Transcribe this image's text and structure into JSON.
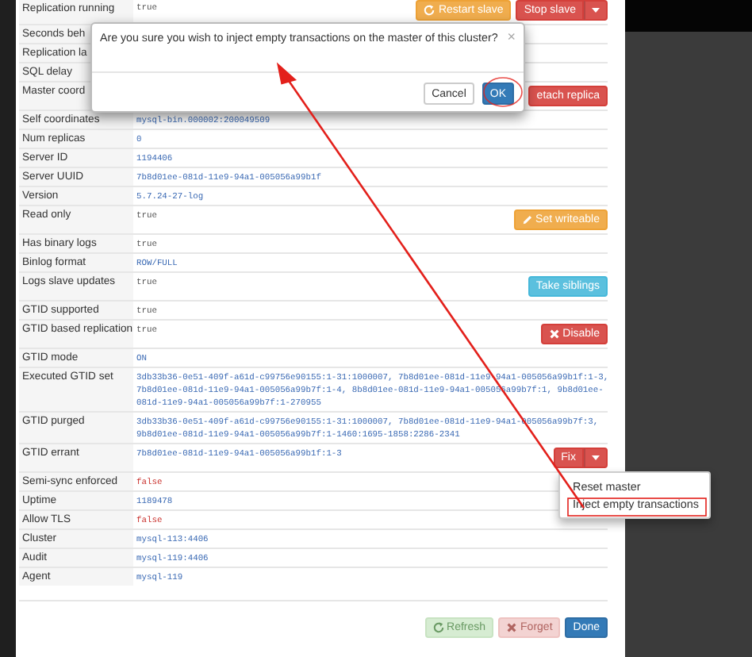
{
  "rows": [
    {
      "label": "Replication running",
      "value": [
        "true"
      ],
      "kind": "flag",
      "actions": [
        {
          "label": "Restart slave",
          "kind": "restart"
        },
        {
          "label": "Stop slave",
          "kind": "stop",
          "caret": true
        }
      ]
    },
    {
      "label": "Seconds beh"
    },
    {
      "label": "Replication la"
    },
    {
      "label": "SQL delay"
    },
    {
      "label": "Master coord",
      "actions": [
        {
          "label": "etach replica",
          "kind": "stop"
        }
      ]
    },
    {
      "label": "Self coordinates",
      "value": [
        "mysql-bin.000002:200049509"
      ],
      "kind": "info"
    },
    {
      "label": "Num replicas",
      "value": [
        "0"
      ],
      "kind": "info"
    },
    {
      "label": "Server ID",
      "value": [
        "1194406"
      ],
      "kind": "info"
    },
    {
      "label": "Server UUID",
      "value": [
        "7b8d01ee-081d-11e9-94a1-005056a99b1f"
      ],
      "kind": "info"
    },
    {
      "label": "Version",
      "value": [
        "5.7.24-27-log"
      ],
      "kind": "info"
    },
    {
      "label": "Read only",
      "value": [
        "true"
      ],
      "kind": "flag",
      "actions": [
        {
          "label": "Set writeable",
          "kind": "edit"
        }
      ]
    },
    {
      "label": "Has binary logs",
      "value": [
        "true"
      ],
      "kind": "flag"
    },
    {
      "label": "Binlog format",
      "value": [
        "ROW/FULL"
      ],
      "kind": "info"
    },
    {
      "label": "Logs slave updates",
      "value": [
        "true"
      ],
      "kind": "flag",
      "actions": [
        {
          "label": "Take siblings",
          "kind": "move"
        }
      ]
    },
    {
      "label": "GTID supported",
      "value": [
        "true"
      ],
      "kind": "flag"
    },
    {
      "label": "GTID based replication",
      "value": [
        "true"
      ],
      "kind": "flag",
      "actions": [
        {
          "label": "Disable",
          "kind": "remove"
        }
      ]
    },
    {
      "label": "GTID mode",
      "value": [
        "ON"
      ],
      "kind": "info"
    },
    {
      "label": "Executed GTID set",
      "value": [
        "3db33b36-0e51-409f-a61d-c99756e90155:1-31:1000007, 7b8d01ee-081d-11e9-94a1-005056a99b1f:1-3,",
        "7b8d01ee-081d-11e9-94a1-005056a99b7f:1-4, 8b8d01ee-081d-11e9-94a1-005056a99b7f:1, 9b8d01ee-",
        "081d-11e9-94a1-005056a99b7f:1-270955"
      ],
      "kind": "info"
    },
    {
      "label": "GTID purged",
      "value": [
        "3db33b36-0e51-409f-a61d-c99756e90155:1-31:1000007, 7b8d01ee-081d-11e9-94a1-005056a99b7f:3,",
        "9b8d01ee-081d-11e9-94a1-005056a99b7f:1-1460:1695-1858:2286-2341"
      ],
      "kind": "info"
    },
    {
      "label": "GTID errant",
      "value": [
        "7b8d01ee-081d-11e9-94a1-005056a99b1f:1-3"
      ],
      "kind": "info",
      "actions": [
        {
          "label": "Fix",
          "kind": "stop",
          "caret": true
        }
      ]
    },
    {
      "label": "Semi-sync enforced",
      "value": [
        "false"
      ],
      "kind": "alert"
    },
    {
      "label": "Uptime",
      "value": [
        "1189478"
      ],
      "kind": "info"
    },
    {
      "label": "Allow TLS",
      "value": [
        "false"
      ],
      "kind": "alert"
    },
    {
      "label": "Cluster",
      "value": [
        "mysql-113:4406"
      ],
      "kind": "info"
    },
    {
      "label": "Audit",
      "value": [
        "mysql-119:4406"
      ],
      "kind": "info"
    },
    {
      "label": "Agent",
      "value": [
        "mysql-119"
      ],
      "kind": "info"
    }
  ],
  "footer": [
    {
      "label": "Refresh",
      "kind": "refresh",
      "disabled": true
    },
    {
      "label": "Forget",
      "kind": "forget",
      "disabled": true
    },
    {
      "label": "Done",
      "kind": "done",
      "disabled": false
    }
  ],
  "fix_menu": {
    "expanded": true,
    "items": [
      "Reset master",
      "Inject empty transactions"
    ]
  },
  "dialog": {
    "message": "Are you sure you wish to inject empty transactions on the master of this cluster?",
    "close": "×",
    "buttons": [
      {
        "label": "Cancel",
        "kind": "cancel"
      },
      {
        "label": "OK",
        "kind": "confirm"
      }
    ]
  }
}
